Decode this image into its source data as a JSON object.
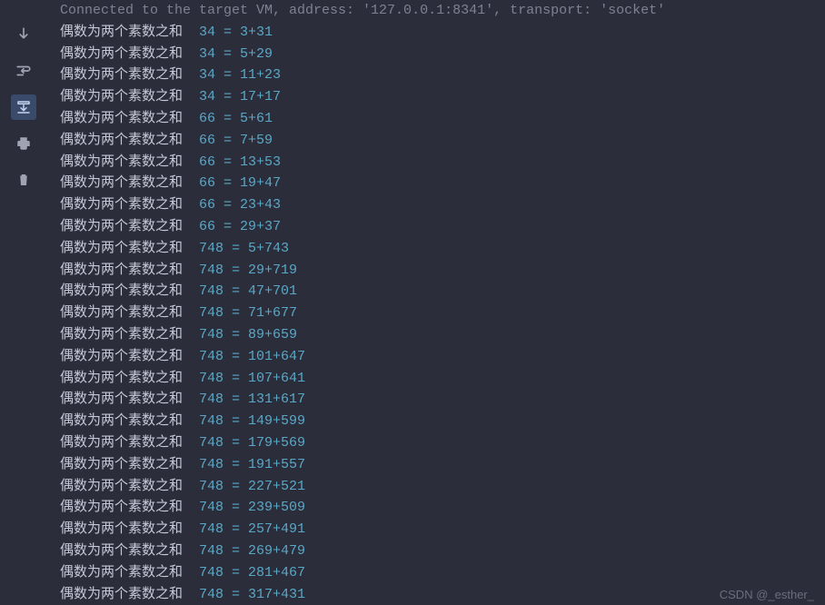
{
  "header_line": "Connected to the target VM, address: '127.0.0.1:8341', transport: 'socket'",
  "line_prefix": "偶数为两个素数之和",
  "output_lines": [
    {
      "n": 34,
      "a": 3,
      "b": 31
    },
    {
      "n": 34,
      "a": 5,
      "b": 29
    },
    {
      "n": 34,
      "a": 11,
      "b": 23
    },
    {
      "n": 34,
      "a": 17,
      "b": 17
    },
    {
      "n": 66,
      "a": 5,
      "b": 61
    },
    {
      "n": 66,
      "a": 7,
      "b": 59
    },
    {
      "n": 66,
      "a": 13,
      "b": 53
    },
    {
      "n": 66,
      "a": 19,
      "b": 47
    },
    {
      "n": 66,
      "a": 23,
      "b": 43
    },
    {
      "n": 66,
      "a": 29,
      "b": 37
    },
    {
      "n": 748,
      "a": 5,
      "b": 743
    },
    {
      "n": 748,
      "a": 29,
      "b": 719
    },
    {
      "n": 748,
      "a": 47,
      "b": 701
    },
    {
      "n": 748,
      "a": 71,
      "b": 677
    },
    {
      "n": 748,
      "a": 89,
      "b": 659
    },
    {
      "n": 748,
      "a": 101,
      "b": 647
    },
    {
      "n": 748,
      "a": 107,
      "b": 641
    },
    {
      "n": 748,
      "a": 131,
      "b": 617
    },
    {
      "n": 748,
      "a": 149,
      "b": 599
    },
    {
      "n": 748,
      "a": 179,
      "b": 569
    },
    {
      "n": 748,
      "a": 191,
      "b": 557
    },
    {
      "n": 748,
      "a": 227,
      "b": 521
    },
    {
      "n": 748,
      "a": 239,
      "b": 509
    },
    {
      "n": 748,
      "a": 257,
      "b": 491
    },
    {
      "n": 748,
      "a": 269,
      "b": 479
    },
    {
      "n": 748,
      "a": 281,
      "b": 467
    },
    {
      "n": 748,
      "a": 317,
      "b": 431
    }
  ],
  "watermark": "CSDN @_esther_",
  "gutter_icons": [
    {
      "name": "scroll-down-icon"
    },
    {
      "name": "soft-wrap-icon"
    },
    {
      "name": "scroll-to-end-icon",
      "active": true
    },
    {
      "name": "print-icon"
    },
    {
      "name": "trash-icon"
    }
  ]
}
